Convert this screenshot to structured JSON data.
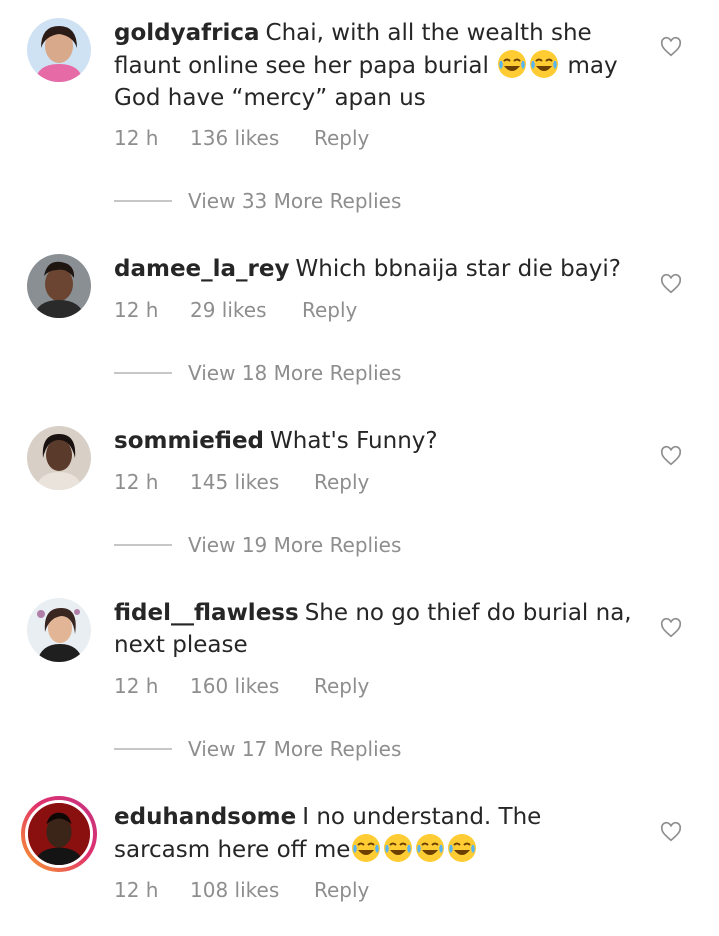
{
  "comments": [
    {
      "username": "goldyafrica",
      "text": "Chai, with all the wealth she flaunt online see her papa burial",
      "emojis_count": 2,
      "text_after": " may God have “mercy” apan us",
      "time": "12 h",
      "likes": "136 likes",
      "reply": "Reply",
      "view_replies": "View 33 More Replies"
    },
    {
      "username": "damee_la_rey",
      "text": "Which bbnaija star die bayi?",
      "time": "12 h",
      "likes": "29 likes",
      "reply": "Reply",
      "view_replies": "View 18 More Replies"
    },
    {
      "username": "sommiefied",
      "text": "What's Funny?",
      "time": "12 h",
      "likes": "145 likes",
      "reply": "Reply",
      "view_replies": "View 19 More Replies"
    },
    {
      "username": "fidel__flawless",
      "text": "She no go thief do burial na, next please",
      "time": "12 h",
      "likes": "160 likes",
      "reply": "Reply",
      "view_replies": "View 17 More Replies"
    },
    {
      "username": "eduhandsome",
      "text": "I no understand. The sarcasm here off me",
      "emojis_count": 4,
      "time": "12 h",
      "likes": "108 likes",
      "reply": "Reply"
    }
  ],
  "icons": {
    "like": "heart-outline-icon",
    "emoji": "face-with-tears-of-joy-icon"
  },
  "colors": {
    "text": "#262626",
    "muted": "#8e8e8e",
    "divider": "#c7c7c7",
    "story_ring": "#e1306c"
  }
}
